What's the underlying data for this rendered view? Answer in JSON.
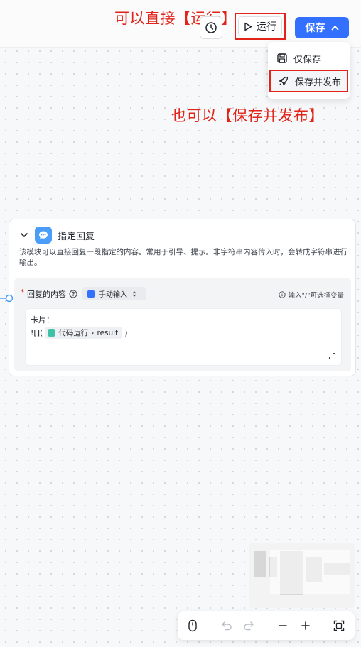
{
  "annotations": {
    "run_hint": "可以直接【运行】",
    "publish_hint": "也可以【保存并发布】"
  },
  "header": {
    "run_label": "运行",
    "save_label": "保存"
  },
  "save_menu": {
    "items": [
      {
        "label": "仅保存",
        "icon": "save-icon"
      },
      {
        "label": "保存并发布",
        "icon": "rocket-icon"
      }
    ]
  },
  "node": {
    "title": "指定回复",
    "description": "该模块可以直接回复一段指定的内容。常用于引导、提示。非字符串内容传入时，会转成字符串进行输出。",
    "field_label": "回复的内容",
    "required_mark": "*",
    "input_mode": "手动输入",
    "hint": "输入\"/\"可选择变量",
    "content_line1": "卡片：",
    "content_prefix": "![](",
    "variable_node": "代码运行",
    "variable_sep": "›",
    "variable_name": "result",
    "content_suffix": ")"
  },
  "colors": {
    "primary": "#3370ff",
    "annotation": "#e2231a",
    "node_icon": "#4a9df8",
    "chip_icon": "#3fc1a8"
  }
}
